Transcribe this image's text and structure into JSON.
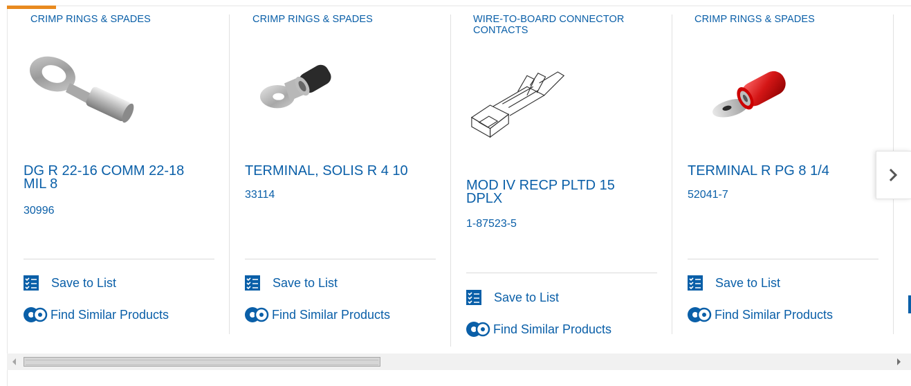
{
  "carousel": {
    "cards": [
      {
        "category": "CRIMP RINGS & SPADES",
        "title": "DG R 22-16 COMM 22-18 MIL 8",
        "part_number": "30996",
        "image": "ring-terminal-silver",
        "save_label": "Save to List",
        "similar_label": "Find Similar Products"
      },
      {
        "category": "CRIMP RINGS & SPADES",
        "title": "TERMINAL, SOLIS R 4 10",
        "part_number": "33114",
        "image": "ring-terminal-dark-barrel",
        "save_label": "Save to List",
        "similar_label": "Find Similar Products"
      },
      {
        "category": "WIRE-TO-BOARD CONNECTOR CONTACTS",
        "title": "MOD IV RECP PLTD 15 DPLX",
        "part_number": "1-87523-5",
        "image": "receptacle-contact-drawing",
        "save_label": "Save to List",
        "similar_label": "Find Similar Products"
      },
      {
        "category": "CRIMP RINGS & SPADES",
        "title": "TERMINAL R PG 8 1/4",
        "part_number": "52041-7",
        "image": "ring-terminal-red-insulated",
        "save_label": "Save to List",
        "similar_label": "Find Similar Products"
      }
    ],
    "next_icon": "chevron-right-icon",
    "colors": {
      "link": "#0a5fa8",
      "accent": "#e88a1f",
      "divider": "#d9d9d9"
    }
  }
}
